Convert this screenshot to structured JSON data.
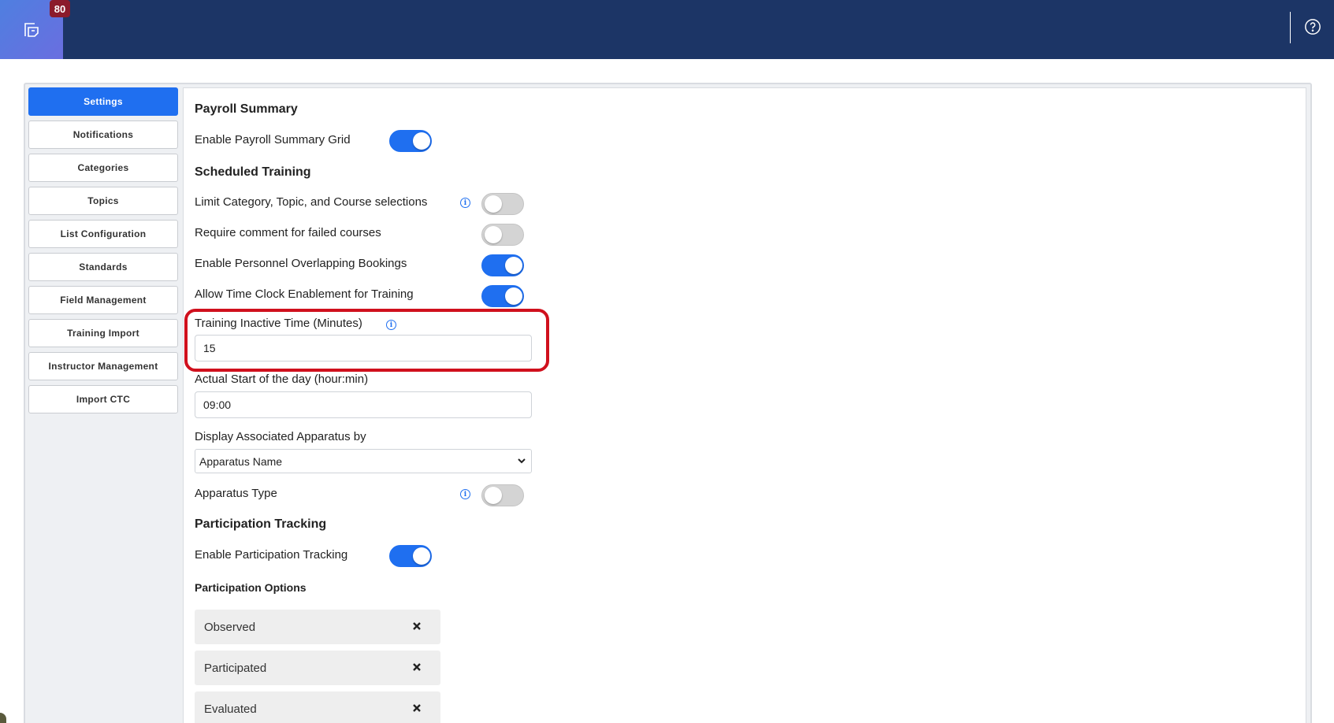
{
  "header": {
    "badge_count": "80",
    "colors": {
      "bar": "#1c3566",
      "accent": "#1f6ff0",
      "badge": "#8b1a2b"
    },
    "icons": {
      "logo": "document-copy-icon",
      "help": "question-circle-icon"
    }
  },
  "sidebar": {
    "items": [
      {
        "label": "Settings",
        "active": true
      },
      {
        "label": "Notifications",
        "active": false
      },
      {
        "label": "Categories",
        "active": false
      },
      {
        "label": "Topics",
        "active": false
      },
      {
        "label": "List Configuration",
        "active": false
      },
      {
        "label": "Standards",
        "active": false
      },
      {
        "label": "Field Management",
        "active": false
      },
      {
        "label": "Training Import",
        "active": false
      },
      {
        "label": "Instructor Management",
        "active": false
      },
      {
        "label": "Import CTC",
        "active": false
      }
    ]
  },
  "payroll": {
    "title": "Payroll Summary",
    "enable_grid_label": "Enable Payroll Summary Grid",
    "enable_grid_on": true
  },
  "scheduled": {
    "title": "Scheduled Training",
    "limit_label": "Limit Category, Topic, and Course selections",
    "limit_on": false,
    "require_comment_label": "Require comment for failed courses",
    "require_comment_on": false,
    "overlap_label": "Enable Personnel Overlapping Bookings",
    "overlap_on": true,
    "timeclock_label": "Allow Time Clock Enablement for Training",
    "timeclock_on": true,
    "inactive_label": "Training Inactive Time (Minutes)",
    "inactive_value": "15",
    "start_label": "Actual Start of the day (hour:min)",
    "start_value": "09:00",
    "apparatus_display_label": "Display Associated Apparatus by",
    "apparatus_display_value": "Apparatus Name",
    "apparatus_type_label": "Apparatus Type",
    "apparatus_type_on": false
  },
  "participation": {
    "title": "Participation Tracking",
    "enable_label": "Enable Participation Tracking",
    "enable_on": true,
    "options_title": "Participation Options",
    "options": [
      "Observed",
      "Participated",
      "Evaluated"
    ]
  }
}
